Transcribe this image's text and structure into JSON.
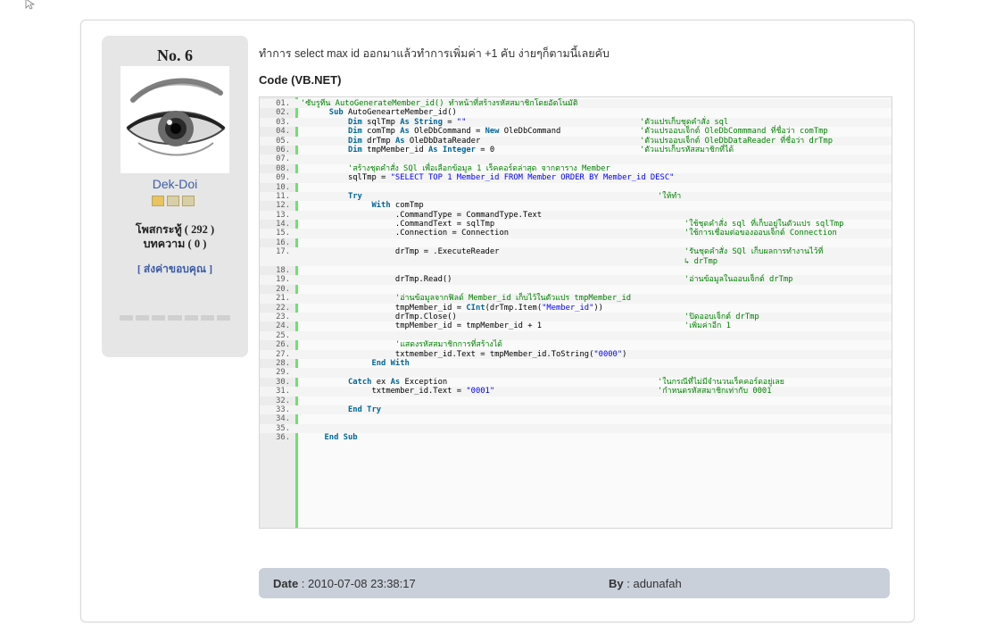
{
  "post": {
    "number": "No. 6",
    "author": {
      "name": "Dek-Doi",
      "posts_label": "โพสกระทู้ ( 292 )",
      "articles_label": "บทความ ( 0 )",
      "thanks_label": "ส่งค่าขอบคุณ",
      "rank_icons": [
        "rank-star-icon",
        "rank-star-icon",
        "rank-star-icon"
      ]
    },
    "intro_text": "ทำการ select max id ออกมาแล้วทำการเพิ่มค่า +1 คับ ง่ายๆก็ตามนี้เลยคับ",
    "code_title": "Code (VB.NET)",
    "code_lines": [
      {
        "n": "01.",
        "segs": [
          {
            "t": "'ซับรูทีน AutoGenerateMember_id() ทำหน้าที่สร้างรหัสสมาชิกโดยอัตโนมัติ",
            "c": "cm"
          }
        ]
      },
      {
        "n": "02.",
        "segs": [
          {
            "t": "      "
          },
          {
            "t": "Sub",
            "c": "kw"
          },
          {
            "t": " AutoGeneartеMember_id()"
          }
        ]
      },
      {
        "n": "03.",
        "segs": [
          {
            "t": "          "
          },
          {
            "t": "Dim",
            "c": "kw"
          },
          {
            "t": " sqlTmp "
          },
          {
            "t": "As",
            "c": "kw"
          },
          {
            "t": " "
          },
          {
            "t": "String",
            "c": "kw"
          },
          {
            "t": " = "
          },
          {
            "t": "\"\"",
            "c": "str"
          }
        ],
        "comment": "'ตัวแปรเก็บชุดคำสั่ง sql",
        "cpos": 426
      },
      {
        "n": "04.",
        "segs": [
          {
            "t": "          "
          },
          {
            "t": "Dim",
            "c": "kw"
          },
          {
            "t": " comTmp "
          },
          {
            "t": "As",
            "c": "kw"
          },
          {
            "t": " OleDbCommand = "
          },
          {
            "t": "New",
            "c": "kw"
          },
          {
            "t": " OleDbCommand"
          }
        ],
        "comment": "'ตัวแปรออบเจ็กต์ OleDbCommmand ที่ชื่อว่า comTmp",
        "cpos": 426
      },
      {
        "n": "05.",
        "segs": [
          {
            "t": "          "
          },
          {
            "t": "Dim",
            "c": "kw"
          },
          {
            "t": " drTmp "
          },
          {
            "t": "As",
            "c": "kw"
          },
          {
            "t": " OleDbDataReader"
          }
        ],
        "comment": "'ตัวแปรออบเจ็กต์ OleDbDataReader ที่ชื่อว่า drTmp",
        "cpos": 426
      },
      {
        "n": "06.",
        "segs": [
          {
            "t": "          "
          },
          {
            "t": "Dim",
            "c": "kw"
          },
          {
            "t": " tmpMember_id "
          },
          {
            "t": "As",
            "c": "kw"
          },
          {
            "t": " "
          },
          {
            "t": "Integer",
            "c": "kw"
          },
          {
            "t": " = 0"
          }
        ],
        "comment": "'ตัวแปรเก็บรหัสสมาชิกที่ได้",
        "cpos": 426
      },
      {
        "n": "07.",
        "segs": []
      },
      {
        "n": "08.",
        "segs": [
          {
            "t": "          "
          },
          {
            "t": "'สร้างชุดคำสั่ง SQl เพื่อเลือกข้อมูล 1 เร็คคอร์ดล่าสุด จากตาราง Member",
            "c": "cm"
          }
        ]
      },
      {
        "n": "09.",
        "segs": [
          {
            "t": "          sqlTmp = "
          },
          {
            "t": "\"SELECT TOP 1 Member_id FROM Member ORDER BY Member_id DESC\"",
            "c": "str"
          }
        ]
      },
      {
        "n": "10.",
        "segs": []
      },
      {
        "n": "11.",
        "segs": [
          {
            "t": "          "
          },
          {
            "t": "Try",
            "c": "kw"
          }
        ],
        "comment": "'ให้ทำ",
        "cpos": 446
      },
      {
        "n": "12.",
        "segs": [
          {
            "t": "               "
          },
          {
            "t": "With",
            "c": "kw"
          },
          {
            "t": " comTmp"
          }
        ]
      },
      {
        "n": "13.",
        "segs": [
          {
            "t": "                    .CommandType = CommandType.Text"
          }
        ]
      },
      {
        "n": "14.",
        "segs": [
          {
            "t": "                    .CommandText = sqlTmp"
          }
        ],
        "comment": "'ใช้ชุดคำสั่ง sql ที่เก็บอยู่ในตัวแปร sqlTmp",
        "cpos": 476
      },
      {
        "n": "15.",
        "segs": [
          {
            "t": "                    .Connection = Connection"
          }
        ],
        "comment": "'ใช้การเชื่อมต่อของออบเจ็กต์ Connection",
        "cpos": 476
      },
      {
        "n": "16.",
        "segs": []
      },
      {
        "n": "17.",
        "segs": [
          {
            "t": "                    drTmp = .ExecuteReader"
          }
        ],
        "comment": "'รันชุดคำสั่ง SQl เก็บผลการทำงานไว้ที่",
        "cpos": 476,
        "wrap": "drTmp",
        "tall": true
      },
      {
        "n": "18.",
        "segs": []
      },
      {
        "n": "19.",
        "segs": [
          {
            "t": "                    drTmp.Read()"
          }
        ],
        "comment": "'อ่านข้อมูลในออบเจ็กต์ drTmp",
        "cpos": 476
      },
      {
        "n": "20.",
        "segs": []
      },
      {
        "n": "21.",
        "segs": [
          {
            "t": "                    "
          },
          {
            "t": "'อ่านข้อมูลจากฟิลด์ Member_id เก็บไว้ในตัวแปร tmpMember_id",
            "c": "cm"
          }
        ]
      },
      {
        "n": "22.",
        "segs": [
          {
            "t": "                    tmpMember_id = "
          },
          {
            "t": "CInt",
            "c": "kw"
          },
          {
            "t": "(drTmp.Item("
          },
          {
            "t": "\"Member_id\"",
            "c": "str"
          },
          {
            "t": "))"
          }
        ]
      },
      {
        "n": "23.",
        "segs": [
          {
            "t": "                    drTmp.Close()"
          }
        ],
        "comment": "'ปิดออบเจ็กต์ drTmp",
        "cpos": 476
      },
      {
        "n": "24.",
        "segs": [
          {
            "t": "                    tmpMember_id = tmpMember_id + 1"
          }
        ],
        "comment": "'เพิ่มค่าอีก 1",
        "cpos": 476
      },
      {
        "n": "25.",
        "segs": []
      },
      {
        "n": "26.",
        "segs": [
          {
            "t": "                    "
          },
          {
            "t": "'แสดงรหัสสมาชิกการที่สร้างได้",
            "c": "cm"
          }
        ]
      },
      {
        "n": "27.",
        "segs": [
          {
            "t": "                    txtmember_id.Text = tmpMember_id.ToString("
          },
          {
            "t": "\"0000\"",
            "c": "str"
          },
          {
            "t": ")"
          }
        ]
      },
      {
        "n": "28.",
        "segs": [
          {
            "t": "               "
          },
          {
            "t": "End With",
            "c": "kw"
          }
        ]
      },
      {
        "n": "29.",
        "segs": []
      },
      {
        "n": "30.",
        "segs": [
          {
            "t": "          "
          },
          {
            "t": "Catch",
            "c": "kw"
          },
          {
            "t": " ex "
          },
          {
            "t": "As",
            "c": "kw"
          },
          {
            "t": " Exception"
          }
        ],
        "comment": "'ในกรณีที่ไม่มีจำนวนเร็คคอร์ดอยู่เลย",
        "cpos": 446
      },
      {
        "n": "31.",
        "segs": [
          {
            "t": "               txtmember_id.Text = "
          },
          {
            "t": "\"0001\"",
            "c": "str"
          }
        ],
        "comment": "'กำหนดรหัสสมาชิกเท่ากับ 0001",
        "cpos": 446
      },
      {
        "n": "32.",
        "segs": []
      },
      {
        "n": "33.",
        "segs": [
          {
            "t": "          "
          },
          {
            "t": "End Try",
            "c": "kw"
          }
        ]
      },
      {
        "n": "34.",
        "segs": []
      },
      {
        "n": "35.",
        "segs": []
      },
      {
        "n": "36.",
        "segs": [
          {
            "t": "     "
          },
          {
            "t": "End Sub",
            "c": "kw"
          }
        ]
      }
    ],
    "footer": {
      "date_label": "Date",
      "date_value": " : 2010-07-08 23:38:17",
      "by_label": "By",
      "by_value": " : adunafah"
    }
  },
  "colors": {
    "link": "#3d5da6",
    "keyword": "#006699",
    "string": "#0000ff",
    "comment": "#008200",
    "code_gutter_bar": "#6ce26c",
    "footer_bg": "#c9d0da",
    "sidebar_bg": "#e6e6e6"
  }
}
